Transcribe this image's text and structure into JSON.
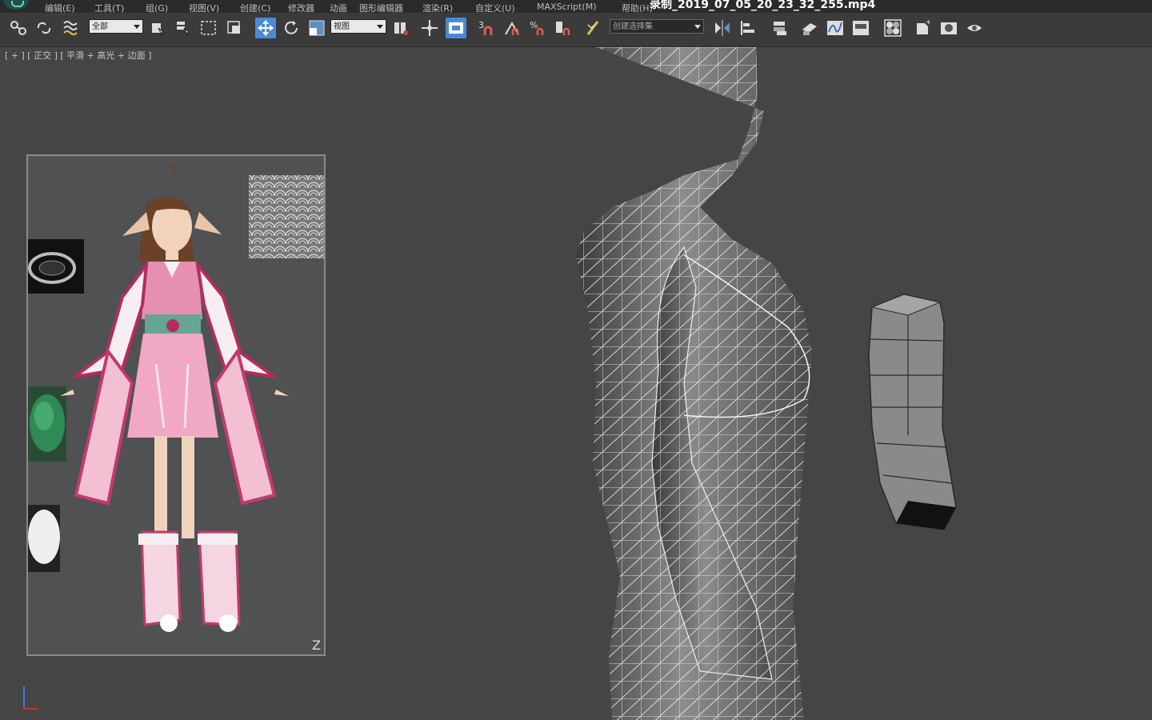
{
  "app": {
    "window_title": "录制_2019_07_05_20_23_32_255.mp4",
    "menu": [
      "编辑(E)",
      "工具(T)",
      "组(G)",
      "视图(V)",
      "创建(C)",
      "修改器",
      "动画",
      "图形编辑器",
      "渲染(R)",
      "自定义(U)",
      "MAXScript(M)",
      "帮助(H)"
    ]
  },
  "toolbar": {
    "selection_filter": "全部",
    "reference_coord": "视图",
    "named_selection_placeholder": "创建选择集",
    "snap_label_3": "3",
    "percent_snap_label": "%",
    "icons": [
      "link-icon",
      "unlink-icon",
      "bind-spacewarp-icon",
      "select-object-icon",
      "select-by-name-icon",
      "rect-region-icon",
      "window-crossing-icon",
      "select-move-icon",
      "select-rotate-icon",
      "select-scale-icon",
      "pivot-icon",
      "manipulate-icon",
      "keyboard-shortcut-icon",
      "snap-toggle-icon",
      "angle-snap-icon",
      "percent-snap-icon",
      "spinner-snap-icon",
      "edit-named-sel-icon",
      "mirror-icon",
      "align-icon",
      "layer-manager-icon",
      "graphite-icon",
      "curve-editor-icon",
      "schematic-view-icon",
      "material-editor-icon",
      "render-setup-icon",
      "rendered-frame-icon",
      "render-icon"
    ]
  },
  "viewport": {
    "label": "[ + ] [ 正交 ] [ 平滑 + 高光 + 边面 ]",
    "corner_mark": "Z"
  },
  "colors": {
    "viewport_bg": "#454545",
    "toolbar_bg": "#3b3b3b",
    "menubar_bg": "#2b2b2b",
    "active_tool": "#4c8ad6"
  }
}
